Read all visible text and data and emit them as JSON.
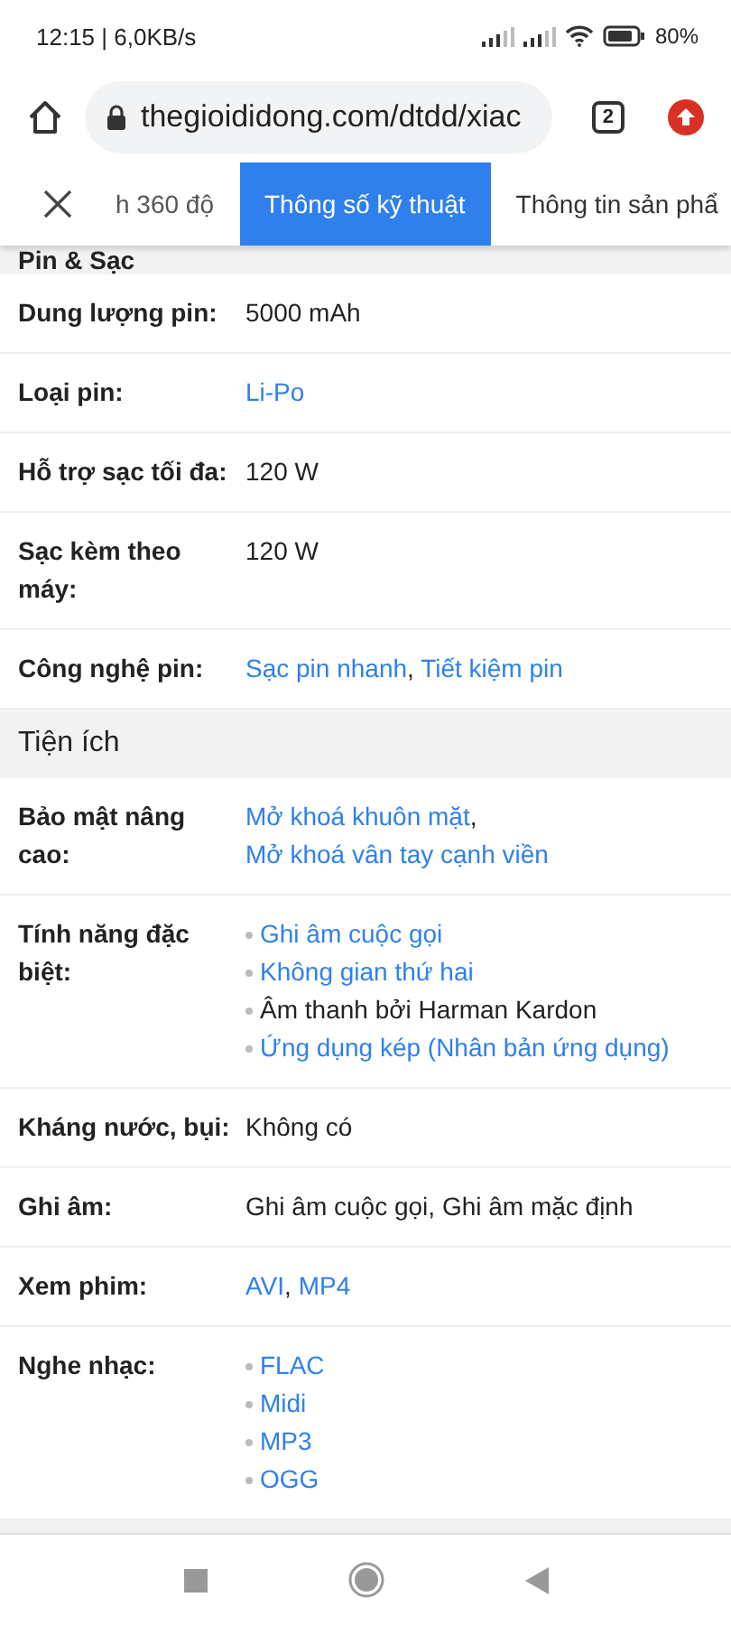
{
  "status_bar": {
    "time": "12:15 | 6,0KB/s",
    "battery": "80%"
  },
  "browser": {
    "url": "thegioididong.com/dtdd/xiac",
    "tab_count": "2"
  },
  "tabs": [
    {
      "label": "h 360 độ",
      "selected": false
    },
    {
      "label": "Thông số kỹ thuật",
      "selected": true
    },
    {
      "label": "Thông tin sản phẩ",
      "selected": false
    }
  ],
  "sections": [
    {
      "title": "Pin & Sạc",
      "rows": [
        {
          "label": "Dung lượng pin:",
          "kind": "inline",
          "parts": [
            {
              "text": "5000 mAh",
              "link": false
            }
          ]
        },
        {
          "label": "Loại pin:",
          "kind": "inline",
          "parts": [
            {
              "text": "Li-Po",
              "link": true
            }
          ]
        },
        {
          "label": "Hỗ trợ sạc tối đa:",
          "kind": "inline",
          "parts": [
            {
              "text": "120 W",
              "link": false
            }
          ]
        },
        {
          "label": "Sạc kèm theo máy:",
          "kind": "inline",
          "parts": [
            {
              "text": "120 W",
              "link": false
            }
          ]
        },
        {
          "label": "Công nghệ pin:",
          "kind": "inline",
          "parts": [
            {
              "text": "Sạc pin nhanh",
              "link": true
            },
            {
              "text": ", ",
              "link": false
            },
            {
              "text": "Tiết kiệm pin",
              "link": true
            }
          ]
        }
      ]
    },
    {
      "title": "Tiện ích",
      "rows": [
        {
          "label": "Bảo mật nâng cao:",
          "kind": "inline",
          "parts": [
            {
              "text": "Mở khoá khuôn mặt",
              "link": true
            },
            {
              "text": ", ",
              "link": false
            },
            {
              "text": "Mở khoá vân tay cạnh viền",
              "link": true
            }
          ]
        },
        {
          "label": "Tính năng đặc biệt:",
          "kind": "list",
          "parts": [
            {
              "text": "Ghi âm cuộc gọi",
              "link": true
            },
            {
              "text": "Không gian thứ hai",
              "link": true
            },
            {
              "text": "Âm thanh bởi Harman Kardon",
              "link": false
            },
            {
              "text": "Ứng dụng kép (Nhân bản ứng dụng)",
              "link": true
            }
          ]
        },
        {
          "label": "Kháng nước, bụi:",
          "kind": "inline",
          "parts": [
            {
              "text": "Không có",
              "link": false
            }
          ]
        },
        {
          "label": "Ghi âm:",
          "kind": "inline",
          "parts": [
            {
              "text": "Ghi âm cuộc gọi, Ghi âm mặc định",
              "link": false
            }
          ]
        },
        {
          "label": "Xem phim:",
          "kind": "inline",
          "parts": [
            {
              "text": "AVI",
              "link": true
            },
            {
              "text": ", ",
              "link": false
            },
            {
              "text": "MP4",
              "link": true
            }
          ]
        },
        {
          "label": "Nghe nhạc:",
          "kind": "list",
          "parts": [
            {
              "text": "FLAC",
              "link": true
            },
            {
              "text": "Midi",
              "link": true
            },
            {
              "text": "MP3",
              "link": true
            },
            {
              "text": "OGG",
              "link": true
            }
          ]
        }
      ]
    }
  ]
}
